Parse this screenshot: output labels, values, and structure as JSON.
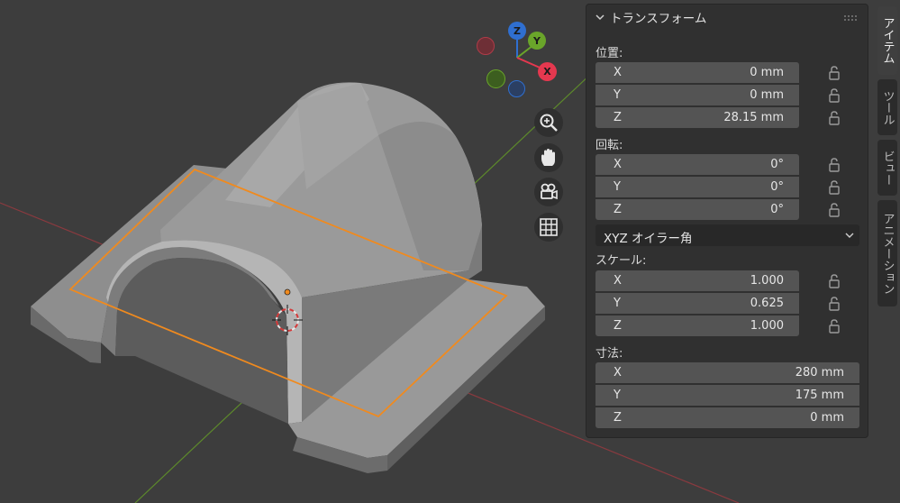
{
  "gizmo": {
    "axes": [
      {
        "name": "z",
        "label": "Z",
        "color": "#2f6fd0"
      },
      {
        "name": "y",
        "label": "Y",
        "color": "#6aa52a"
      },
      {
        "name": "x",
        "label": "X",
        "color": "#e5384f"
      }
    ]
  },
  "nav_buttons": [
    {
      "name": "zoom",
      "icon": "zoom-icon"
    },
    {
      "name": "pan",
      "icon": "hand-icon"
    },
    {
      "name": "camera",
      "icon": "camera-icon"
    },
    {
      "name": "ortho",
      "icon": "grid-icon"
    }
  ],
  "panel": {
    "title": "トランスフォーム",
    "location": {
      "label": "位置:",
      "x": {
        "axis": "X",
        "value": "0 mm"
      },
      "y": {
        "axis": "Y",
        "value": "0 mm"
      },
      "z": {
        "axis": "Z",
        "value": "28.15 mm"
      }
    },
    "rotation": {
      "label": "回転:",
      "x": {
        "axis": "X",
        "value": "0°"
      },
      "y": {
        "axis": "Y",
        "value": "0°"
      },
      "z": {
        "axis": "Z",
        "value": "0°"
      },
      "mode": "XYZ オイラー角"
    },
    "scale": {
      "label": "スケール:",
      "x": {
        "axis": "X",
        "value": "1.000"
      },
      "y": {
        "axis": "Y",
        "value": "0.625"
      },
      "z": {
        "axis": "Z",
        "value": "1.000"
      }
    },
    "dimensions": {
      "label": "寸法:",
      "x": {
        "axis": "X",
        "value": "280 mm"
      },
      "y": {
        "axis": "Y",
        "value": "175 mm"
      },
      "z": {
        "axis": "Z",
        "value": "0 mm"
      }
    }
  },
  "side_tabs": {
    "item": "アイテム",
    "tool": "ツール",
    "view": "ビュー",
    "animation": "アニメーション"
  },
  "colors": {
    "viewport_bg": "#3d3d3d",
    "selection_outline": "#f08a1e",
    "x_axis_line": "#8a3a3f",
    "y_axis_line": "#5d8a2b"
  }
}
